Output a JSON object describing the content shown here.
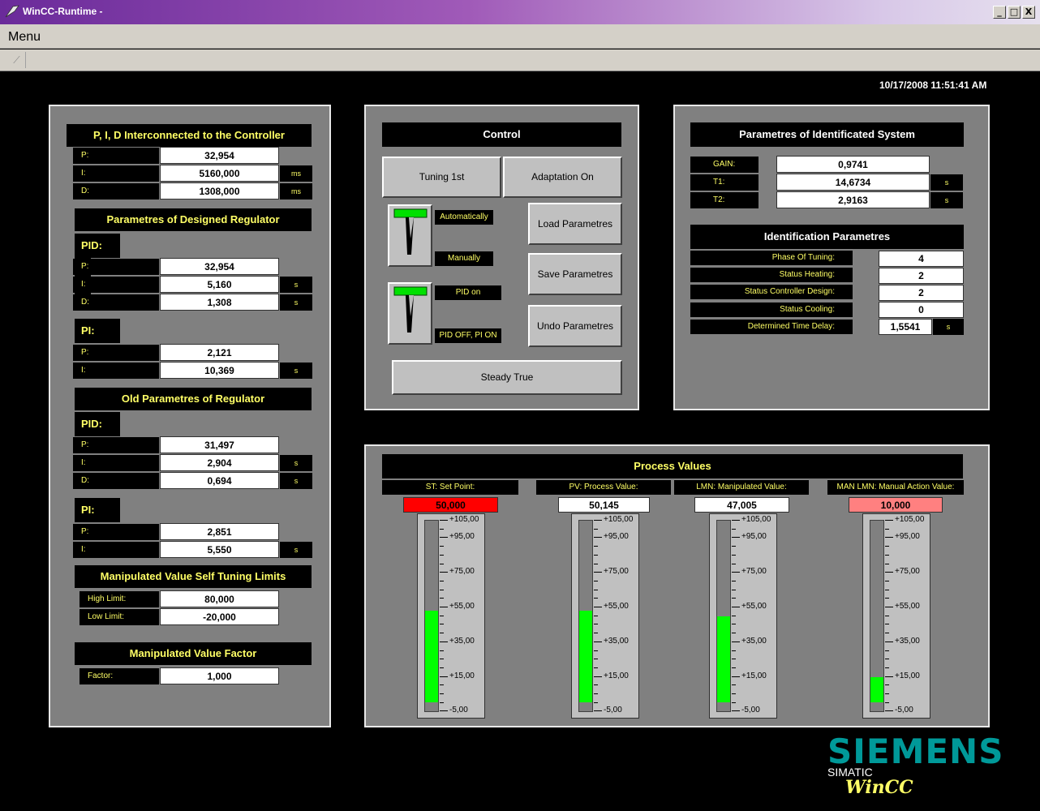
{
  "window": {
    "title": "WinCC-Runtime -",
    "min": "_",
    "max": "□",
    "close": "X"
  },
  "menu": {
    "label": "Menu"
  },
  "timestamp": "10/17/2008 11:51:41 AM",
  "left": {
    "pid_conn": {
      "title": "P, I, D Interconnected to the Controller",
      "rows": [
        {
          "label": "P:",
          "value": "32,954",
          "unit": ""
        },
        {
          "label": "I:",
          "value": "5160,000",
          "unit": "ms"
        },
        {
          "label": "D:",
          "value": "1308,000",
          "unit": "ms"
        }
      ]
    },
    "designed": {
      "title": "Parametres of Designed Regulator",
      "pid_label": "PID:",
      "pid_rows": [
        {
          "label": "P:",
          "value": "32,954",
          "unit": ""
        },
        {
          "label": "I:",
          "value": "5,160",
          "unit": "s"
        },
        {
          "label": "D:",
          "value": "1,308",
          "unit": "s"
        }
      ],
      "pi_label": "PI:",
      "pi_rows": [
        {
          "label": "P:",
          "value": "2,121",
          "unit": ""
        },
        {
          "label": "I:",
          "value": "10,369",
          "unit": "s"
        }
      ]
    },
    "old": {
      "title": "Old Parametres of Regulator",
      "pid_label": "PID:",
      "pid_rows": [
        {
          "label": "P:",
          "value": "31,497",
          "unit": ""
        },
        {
          "label": "I:",
          "value": "2,904",
          "unit": "s"
        },
        {
          "label": "D:",
          "value": "0,694",
          "unit": "s"
        }
      ],
      "pi_label": "PI:",
      "pi_rows": [
        {
          "label": "P:",
          "value": "2,851",
          "unit": ""
        },
        {
          "label": "I:",
          "value": "5,550",
          "unit": "s"
        }
      ]
    },
    "limits": {
      "title": "Manipulated Value Self Tuning Limits",
      "rows": [
        {
          "label": "High Limit:",
          "value": "80,000"
        },
        {
          "label": "Low Limit:",
          "value": "-20,000"
        }
      ]
    },
    "factor": {
      "title": "Manipulated Value Factor",
      "label": "Factor:",
      "value": "1,000"
    }
  },
  "control": {
    "title": "Control",
    "tuning_btn": "Tuning 1st",
    "adaptation_btn": "Adaptation On",
    "switch1": {
      "on": "Automatically",
      "off": "Manually"
    },
    "switch2": {
      "on": "PID on",
      "off": "PID OFF, PI ON"
    },
    "load_btn": "Load Parametres",
    "save_btn": "Save Parametres",
    "undo_btn": "Undo Parametres",
    "steady_btn": "Steady True"
  },
  "ident": {
    "title": "Parametres of Identificated System",
    "rows": [
      {
        "label": "GAIN:",
        "value": "0,9741",
        "unit": ""
      },
      {
        "label": "T1:",
        "value": "14,6734",
        "unit": "s"
      },
      {
        "label": "T2:",
        "value": "2,9163",
        "unit": "s"
      }
    ],
    "params_title": "Identification Parametres",
    "params": [
      {
        "label": "Phase Of Tuning:",
        "value": "4",
        "unit": ""
      },
      {
        "label": "Status Heating:",
        "value": "2",
        "unit": ""
      },
      {
        "label": "Status Controller Design:",
        "value": "2",
        "unit": ""
      },
      {
        "label": "Status Cooling:",
        "value": "0",
        "unit": ""
      },
      {
        "label": "Determined Time Delay:",
        "value": "1,5541",
        "unit": "s"
      }
    ]
  },
  "process": {
    "title": "Process Values",
    "scale": [
      "+105,00",
      "+95,00",
      "+75,00",
      "+55,00",
      "+35,00",
      "+15,00",
      "-5,00"
    ],
    "scale_min": -5,
    "scale_max": 105,
    "gauges": [
      {
        "label": "ST: Set Point:",
        "value": "50,000",
        "level": 50.0,
        "bg": "#ff0000"
      },
      {
        "label": "PV: Process Value:",
        "value": "50,145",
        "level": 50.145,
        "bg": "#ffffff"
      },
      {
        "label": "LMN: Manipulated Value:",
        "value": "47,005",
        "level": 47.005,
        "bg": "#ffffff"
      },
      {
        "label": "MAN LMN: Manual Action Value:",
        "value": "10,000",
        "level": 10.0,
        "bg": "#ff8080"
      }
    ]
  },
  "logo": {
    "brand": "SIEMENS",
    "line2": "SIMATIC",
    "line3": "WinCC"
  },
  "colors": {
    "accent": "#ffff66",
    "fill": "#00ff00",
    "panel": "#808080"
  }
}
